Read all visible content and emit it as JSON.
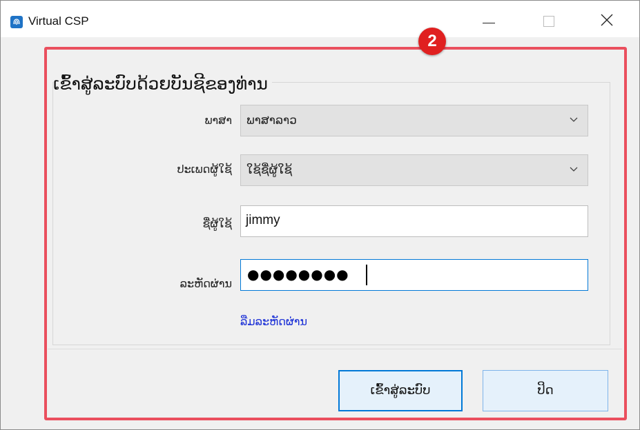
{
  "window": {
    "title": "Virtual CSP"
  },
  "form": {
    "heading": "ເຂົ້າສູ່ລະບົບດ້ວຍບັນຊີຂອງທ່ານ",
    "language_label": "ພາສາ",
    "language_value": "ພາສາລາວ",
    "user_type_label": "ປະເພດຜູ້ໃຊ້",
    "user_type_value": "ໃຊ້ຊື່ຜູ້ໃຊ້",
    "username_label": "ຊື່ຜູ້ໃຊ້",
    "username_value": "jimmy",
    "password_label": "ລະຫັດຜ່ານ",
    "password_value": "●●●●●●●●",
    "forgot_password": "ລືມລະຫັດຜ່ານ"
  },
  "buttons": {
    "login": "ເຂົ້າສູ່ລະບົບ",
    "close": "ປິດ"
  },
  "annotation": {
    "badge": "2",
    "color": "#ea4f5e"
  },
  "icons": [
    "app-fingerprint-icon",
    "minimize-icon",
    "maximize-icon",
    "close-icon",
    "chevron-down-icon"
  ],
  "colors": {
    "accent": "#0078d7",
    "link": "#1a2fd6",
    "badge": "#e02020"
  }
}
